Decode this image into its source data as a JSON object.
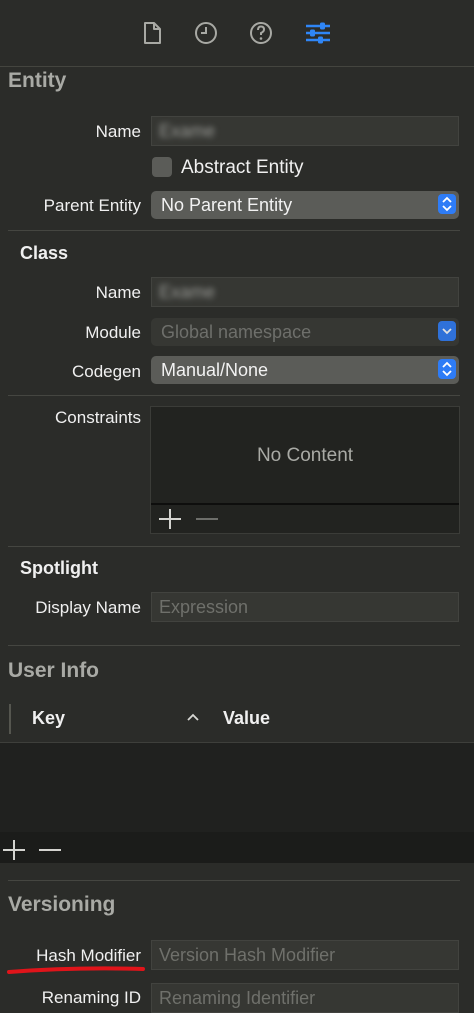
{
  "toolbar": {
    "icons": [
      "file-inspector-icon",
      "history-inspector-icon",
      "quick-help-icon",
      "attributes-inspector-icon"
    ],
    "active_color": "#2f86f6",
    "inactive_color": "#a8a9a4"
  },
  "entity": {
    "heading": "Entity",
    "name_label": "Name",
    "name_value": "Exame",
    "abstract_label": "Abstract Entity",
    "parent_label": "Parent Entity",
    "parent_value": "No Parent Entity"
  },
  "class": {
    "heading": "Class",
    "name_label": "Name",
    "name_value": "Exame",
    "module_label": "Module",
    "module_value": "Global namespace",
    "codegen_label": "Codegen",
    "codegen_value": "Manual/None"
  },
  "constraints": {
    "label": "Constraints",
    "empty_text": "No Content"
  },
  "spotlight": {
    "heading": "Spotlight",
    "display_name_label": "Display Name",
    "display_name_placeholder": "Expression"
  },
  "user_info": {
    "heading": "User Info",
    "col_key": "Key",
    "col_value": "Value",
    "sort_indicator": "^"
  },
  "versioning": {
    "heading": "Versioning",
    "hash_label": "Hash Modifier",
    "hash_placeholder": "Version Hash Modifier",
    "renaming_label": "Renaming ID",
    "renaming_placeholder": "Renaming Identifier",
    "annotation_color": "#e0141a"
  }
}
